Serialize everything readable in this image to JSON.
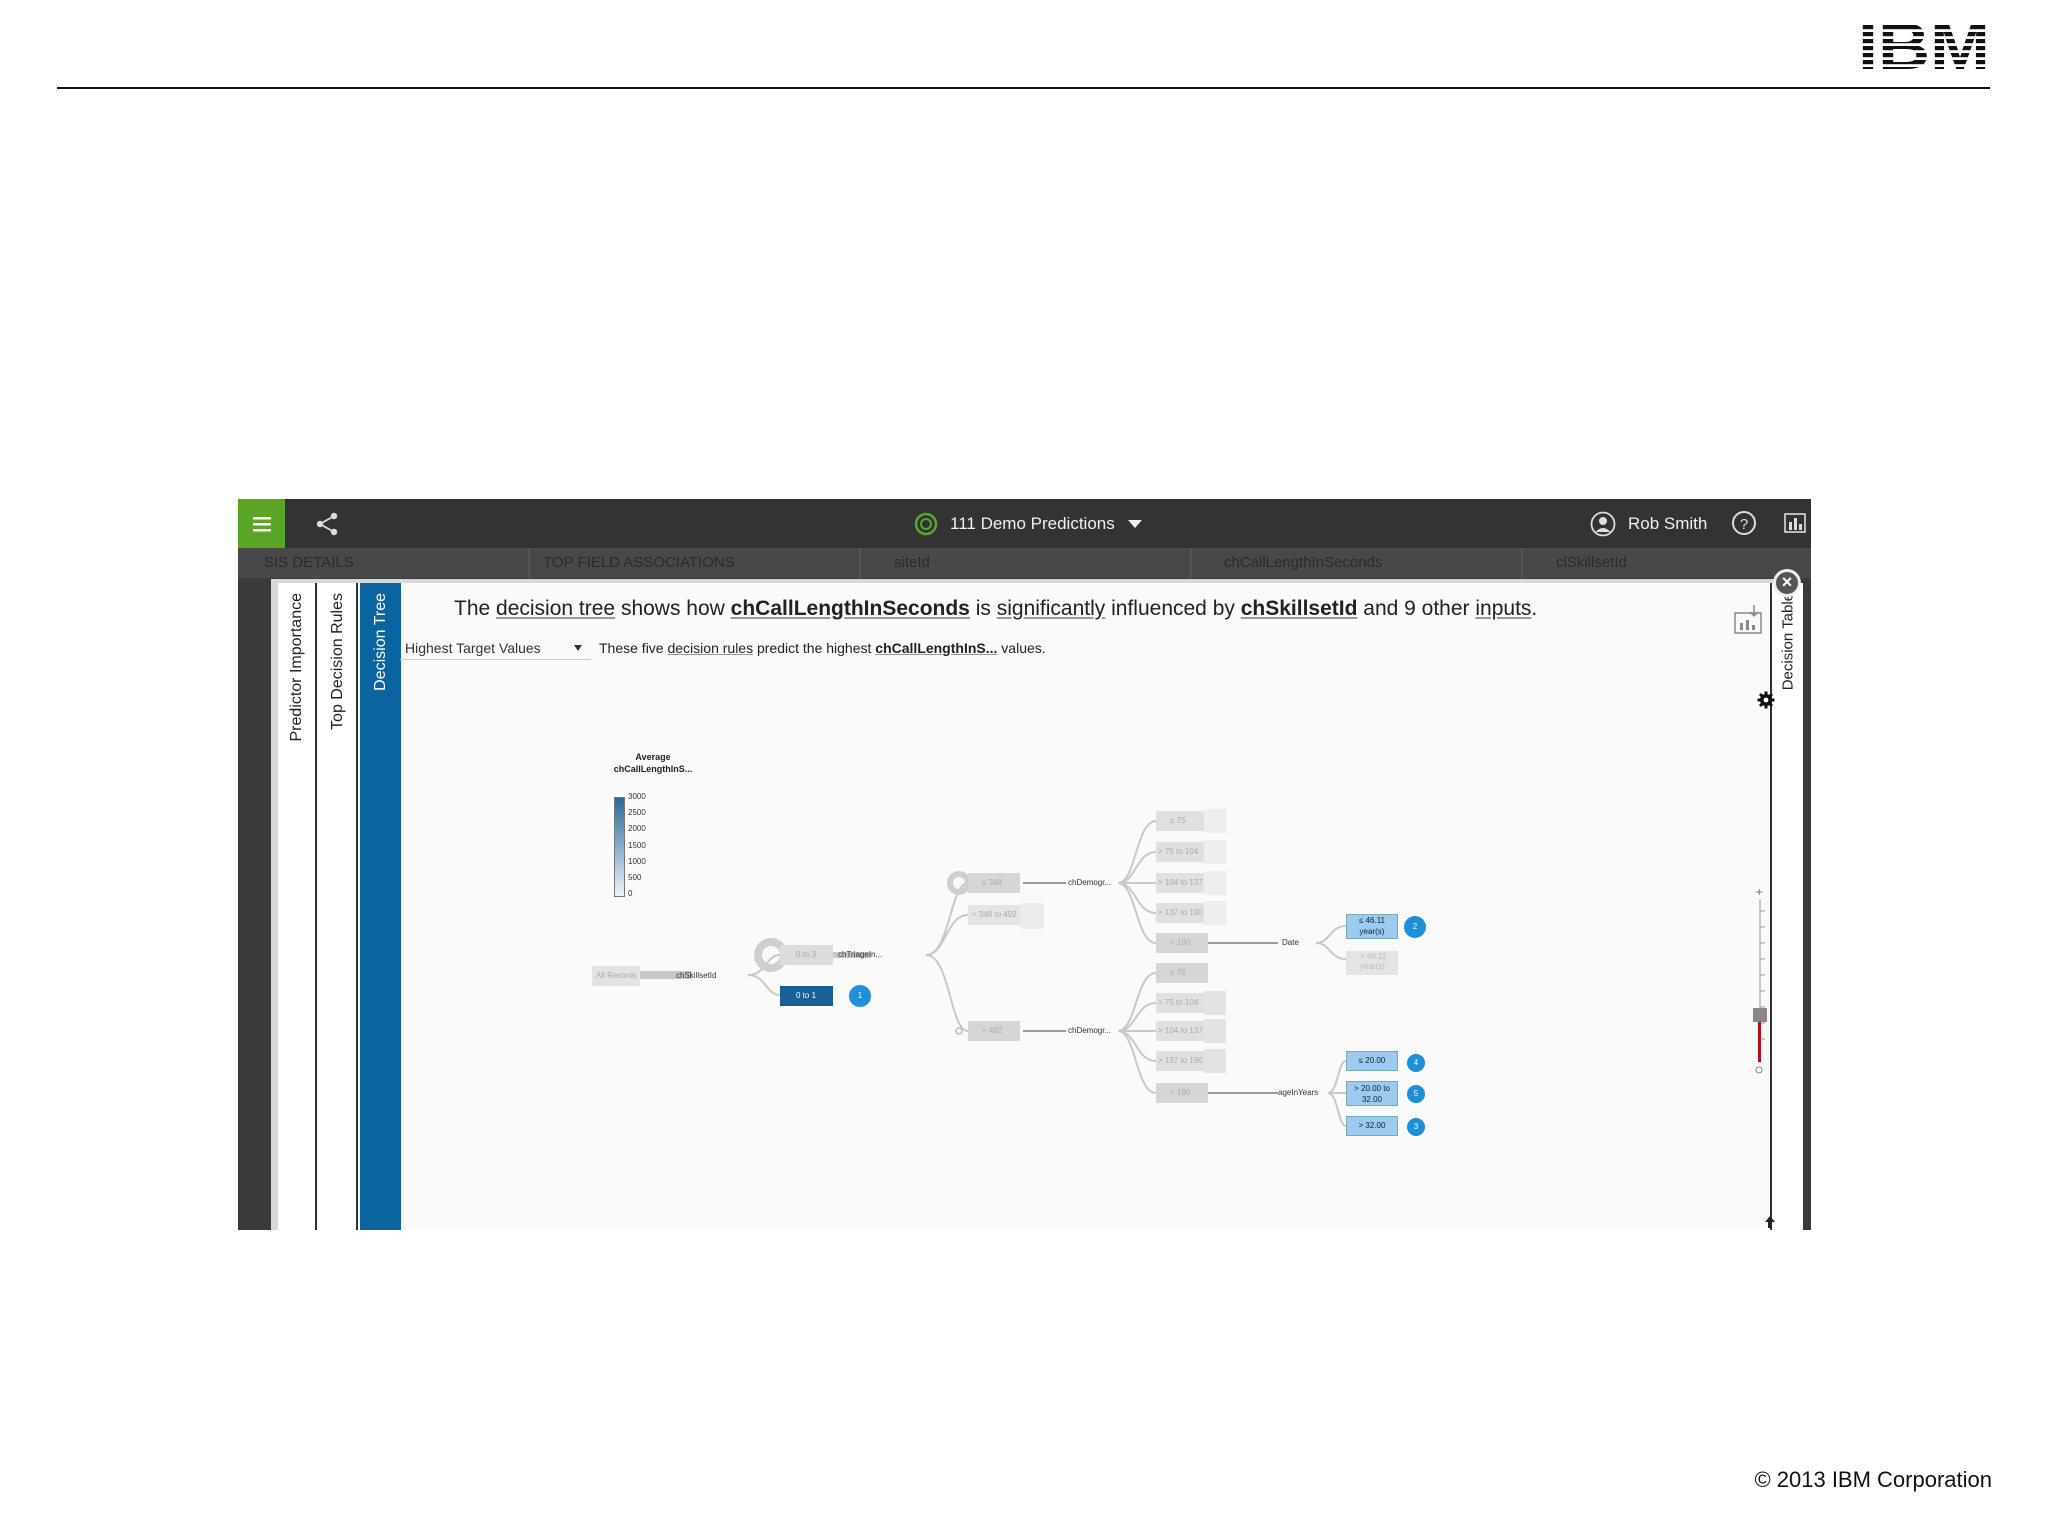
{
  "slide": {
    "logo_text": "IBM",
    "copyright": "© 2013 IBM Corporation"
  },
  "app": {
    "title": "111 Demo Predictions",
    "user_name": "Rob Smith",
    "help_label": "?",
    "colors": {
      "brand_green": "#5aa525",
      "active_tab": "#0a64a0",
      "badge": "#1e8fd8"
    },
    "card_tabs": [
      "SIS DETAILS",
      "TOP FIELD ASSOCIATIONS",
      "siteId",
      "chCallLengthInSeconds",
      "clSkillsetId"
    ]
  },
  "modal": {
    "close_label": "×",
    "tabs": {
      "predictor_importance": "Predictor Importance",
      "top_decision_rules": "Top Decision Rules",
      "decision_tree": "Decision Tree",
      "decision_table": "Decision Table"
    },
    "headline": {
      "p1": "The ",
      "decision_tree": "decision tree",
      "p2": " shows how ",
      "target": "chCallLengthInSeconds",
      "p3": " is ",
      "significantly": "significantly",
      "p4": " influenced by ",
      "predictor": "chSkillsetId",
      "p5": " and 9 other ",
      "inputs": "inputs",
      "p6": "."
    },
    "select_value": "Highest Target Values",
    "subline": {
      "p1": "These five ",
      "decision_rules": "decision rules",
      "p2": " predict the highest ",
      "target": "chCallLengthInS...",
      "p3": " values."
    }
  },
  "legend": {
    "title_line1": "Average",
    "title_line2": "chCallLengthInS...",
    "ticks": [
      "3000",
      "2500",
      "2000",
      "1500",
      "1000",
      "500",
      "0"
    ]
  },
  "tree": {
    "root": "All Records",
    "vars": {
      "skillset": "chSkillsetId",
      "triage": "chTriageIn...",
      "demog_top": "chDemogr...",
      "demog_bottom": "chDemogr...",
      "date": "Date",
      "age": "ageInYears"
    },
    "nodes": {
      "skill_a": "0 to 3",
      "skill_b": "0 to 1",
      "triage_a": "≤ 348",
      "triage_b": "> 348 to 492",
      "triage_c": "> 492",
      "demog_top": [
        "≤ 75",
        "> 75 to 104",
        "> 104 to 137",
        "> 137 to 190",
        "> 190"
      ],
      "demog_bottom": [
        "≤ 75",
        "> 75 to 104",
        "> 104 to 137",
        "> 137 to 190",
        "> 190"
      ],
      "date_a": [
        "≤ 46.11",
        "year(s)"
      ],
      "date_b": [
        "> 46.11",
        "year(s)"
      ],
      "age_leaves": [
        "≤ 20.00",
        "> 20.00 to 32.00",
        "> 32.00"
      ]
    },
    "badges": [
      "1",
      "2",
      "4",
      "5",
      "3"
    ]
  }
}
